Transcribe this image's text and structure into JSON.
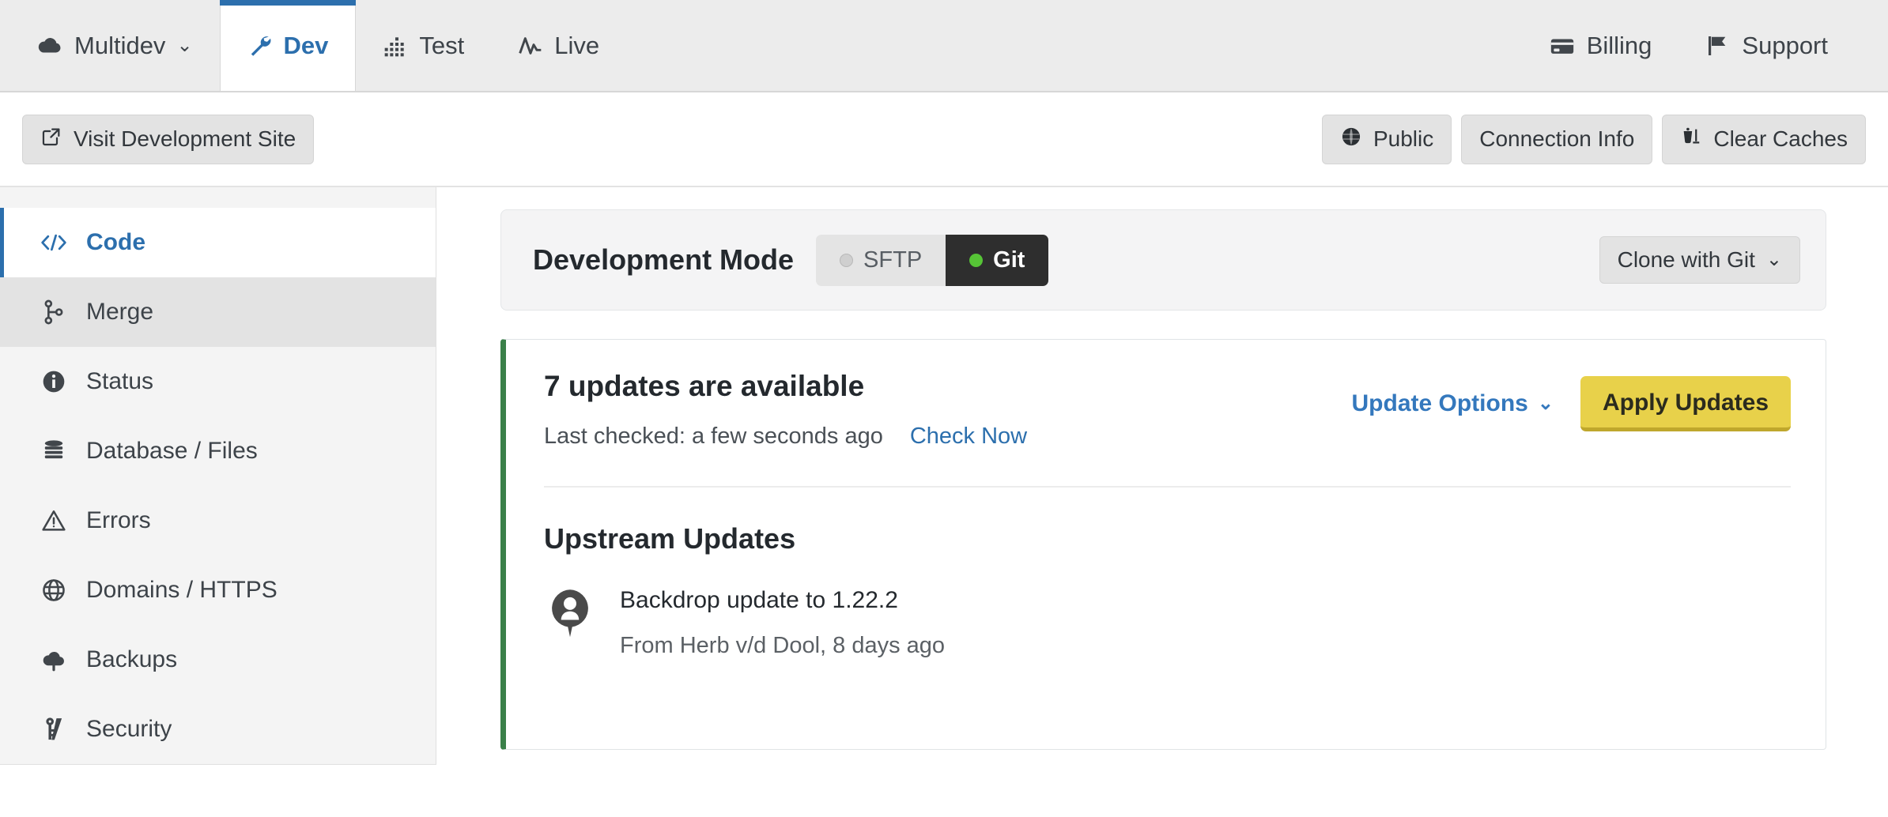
{
  "tabs": {
    "left": [
      {
        "label": "Multidev",
        "icon": "cloud-icon",
        "caret": "⌄",
        "active": false
      },
      {
        "label": "Dev",
        "icon": "wrench-icon",
        "active": true
      },
      {
        "label": "Test",
        "icon": "chart-dots-icon",
        "active": false
      },
      {
        "label": "Live",
        "icon": "pulse-icon",
        "active": false
      }
    ],
    "right": [
      {
        "label": "Billing",
        "icon": "credit-card-icon"
      },
      {
        "label": "Support",
        "icon": "flag-icon"
      }
    ]
  },
  "actionbar": {
    "visit_label": "Visit Development Site",
    "visit_icon": "external-link-icon",
    "right": [
      {
        "label": "Public",
        "icon": "globe-icon"
      },
      {
        "label": "Connection Info",
        "icon": ""
      },
      {
        "label": "Clear Caches",
        "icon": "clear-caches-icon"
      }
    ]
  },
  "sidebar": {
    "items": [
      {
        "label": "Code",
        "icon": "code-brackets-icon",
        "state": "active"
      },
      {
        "label": "Merge",
        "icon": "git-merge-icon",
        "state": "hover"
      },
      {
        "label": "Status",
        "icon": "info-circle-icon",
        "state": ""
      },
      {
        "label": "Database / Files",
        "icon": "database-icon",
        "state": ""
      },
      {
        "label": "Errors",
        "icon": "warning-triangle-icon",
        "state": ""
      },
      {
        "label": "Domains / HTTPS",
        "icon": "globe-icon",
        "state": ""
      },
      {
        "label": "Backups",
        "icon": "cloud-upload-icon",
        "state": ""
      },
      {
        "label": "Security",
        "icon": "key-icon",
        "state": ""
      }
    ]
  },
  "dev_mode": {
    "title": "Development Mode",
    "options": [
      {
        "label": "SFTP",
        "selected": false
      },
      {
        "label": "Git",
        "selected": true
      }
    ],
    "clone_label": "Clone with Git",
    "clone_caret": "⌄"
  },
  "updates": {
    "heading": "7 updates are available",
    "last_checked": "Last checked: a few seconds ago",
    "check_now": "Check Now",
    "options_label": "Update Options",
    "options_caret": "⌄",
    "apply_label": "Apply Updates",
    "upstream_title": "Upstream Updates",
    "items": [
      {
        "title": "Backdrop update to 1.22.2",
        "byline": "From Herb v/d Dool, 8 days ago",
        "avatar": "user-avatar-icon"
      }
    ]
  },
  "colors": {
    "accent_blue": "#2c6fad",
    "green_border": "#3a8049",
    "yellow_button": "#e8d14a",
    "toggle_on_dot": "#56c436"
  }
}
